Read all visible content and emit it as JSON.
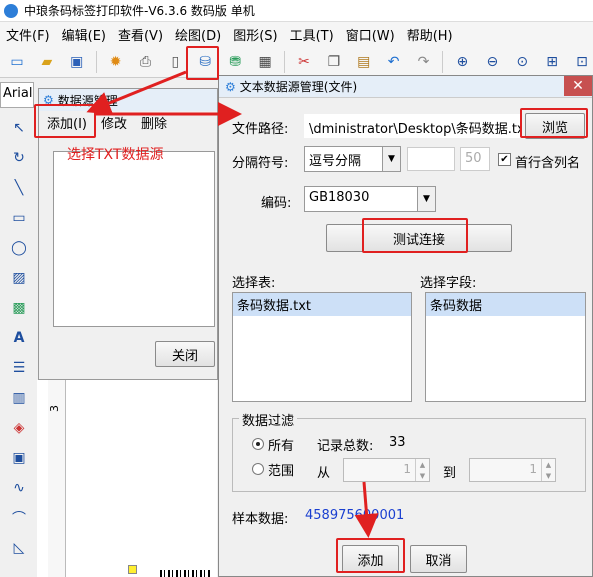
{
  "app": {
    "title": "中琅条码标签打印软件-V6.3.6 数码版 单机",
    "menu": [
      "文件(F)",
      "编辑(E)",
      "查看(V)",
      "绘图(D)",
      "图形(S)",
      "工具(T)",
      "窗口(W)",
      "帮助(H)"
    ],
    "font_name": "Arial",
    "ruler_mark": "3"
  },
  "toolbar_icons": [
    "new-icon",
    "open-icon",
    "settings-icon",
    "print-icon",
    "preview-icon",
    "database-icon",
    "table-icon",
    "grid-icon",
    "cut-icon",
    "copy-icon",
    "paste-icon",
    "undo-icon",
    "redo-icon",
    "zoom-in-icon",
    "zoom-out-icon",
    "zoom-icon",
    "fit-icon",
    "fit-page-icon"
  ],
  "left_tools": [
    "pointer-icon",
    "rotate-icon",
    "line-icon",
    "rect-icon",
    "ellipse-icon",
    "image-icon",
    "picture-icon",
    "text-icon",
    "rich-text-icon",
    "barcode-icon",
    "seal-icon",
    "qrcode-icon",
    "curve-icon",
    "arc-icon",
    "polygon-icon"
  ],
  "datasource_dialog": {
    "title": "数据源管理",
    "menu": {
      "add": "添加(I)",
      "edit": "修改",
      "delete": "删除"
    },
    "close_label": "关闭"
  },
  "annotation": "选择TXT数据源",
  "file_dialog": {
    "title": "文本数据源管理(文件)",
    "close_glyph": "✕",
    "file_path_label": "文件路径:",
    "file_path_value": "\\dministrator\\Desktop\\条码数据.txt",
    "browse_label": "浏览",
    "separator_label": "分隔符号:",
    "separator_value": "逗号分隔",
    "separator_custom": "",
    "separator_count": "50",
    "first_row_label": "首行含列名",
    "first_row_checked": true,
    "encoding_label": "编码:",
    "encoding_value": "GB18030",
    "test_label": "测试连接",
    "select_table_label": "选择表:",
    "tables": [
      "条码数据.txt"
    ],
    "select_field_label": "选择字段:",
    "fields": [
      "条码数据"
    ],
    "filter_legend": "数据过滤",
    "radio_all": "所有",
    "record_total_label": "记录总数:",
    "record_total": "33",
    "radio_range": "范围",
    "from_label": "从",
    "from_value": "1",
    "to_label": "到",
    "to_value": "1",
    "sample_label": "样本数据:",
    "sample_value": "458975600001",
    "add_label": "添加",
    "cancel_label": "取消"
  }
}
